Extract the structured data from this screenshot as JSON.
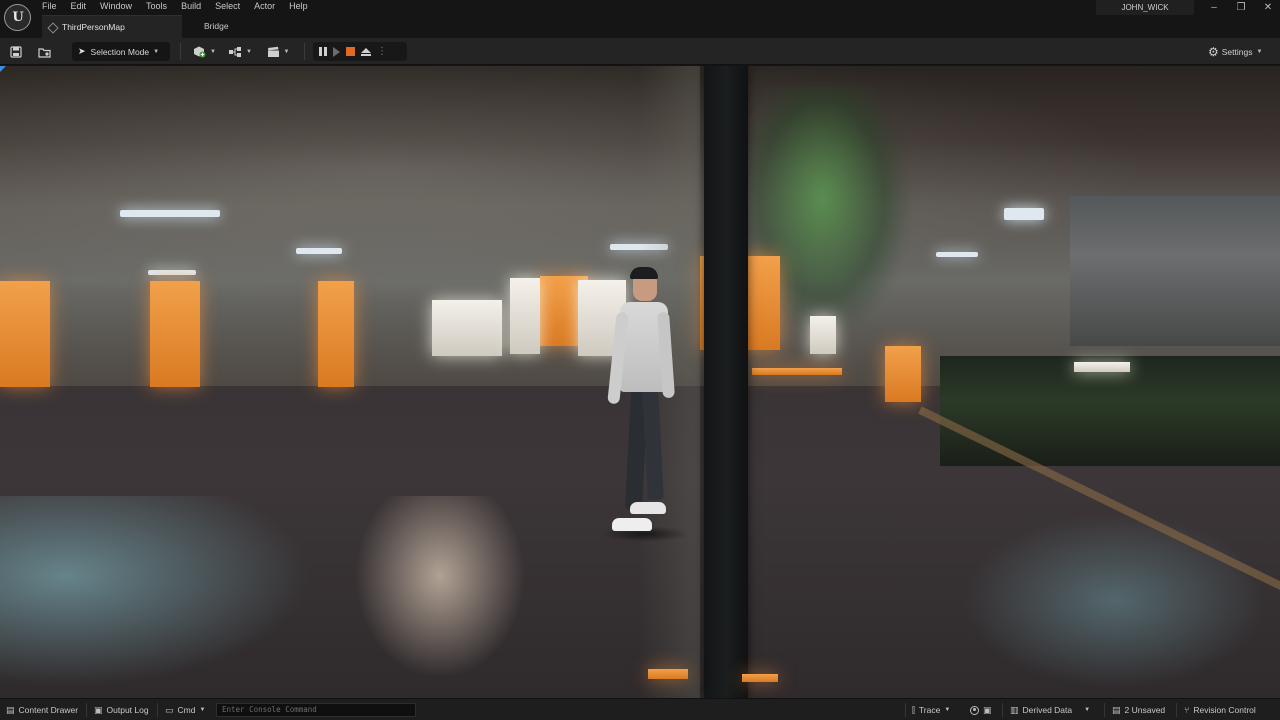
{
  "app": {
    "logo_letter": "U"
  },
  "menu": [
    "File",
    "Edit",
    "Window",
    "Tools",
    "Build",
    "Select",
    "Actor",
    "Help"
  ],
  "tabs": [
    {
      "label": "ThirdPersonMap",
      "active": true
    },
    {
      "label": "Bridge",
      "active": false
    }
  ],
  "user": {
    "name": "JOHN_WICK"
  },
  "window_controls": {
    "minimize": "–",
    "restore": "❐",
    "close": "✕"
  },
  "toolbar": {
    "selection_mode": "Selection Mode",
    "settings": "Settings"
  },
  "statusbar": {
    "content_drawer": "Content Drawer",
    "output_log": "Output Log",
    "cmd": "Cmd",
    "console_placeholder": "Enter Console Command",
    "trace": "Trace",
    "derived_data": "Derived Data",
    "unsaved": "2 Unsaved",
    "revision_control": "Revision Control"
  },
  "colors": {
    "accent": "#3d8fe0",
    "stop_button": "#e06a22",
    "background": "#151515"
  }
}
